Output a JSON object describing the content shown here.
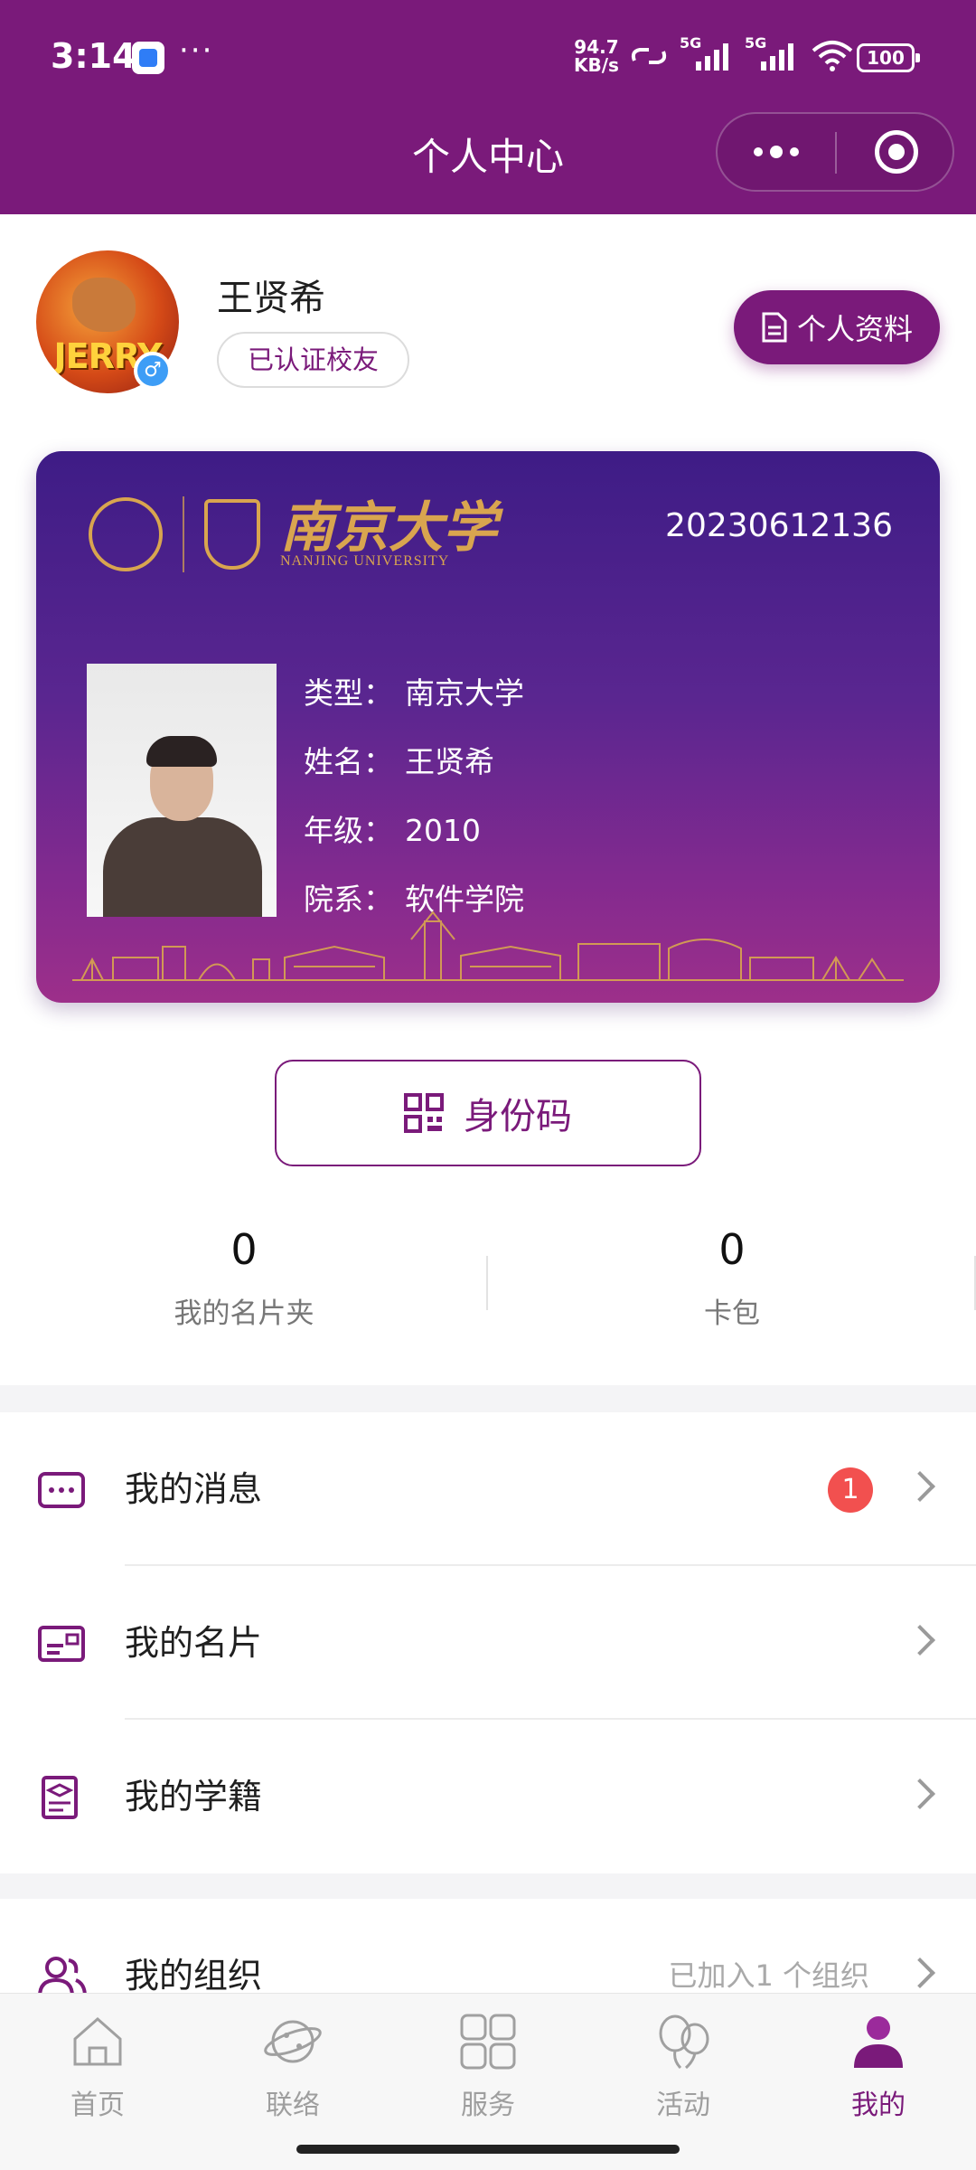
{
  "status": {
    "time": "3:14",
    "more": "···",
    "speed_value": "94.7",
    "speed_unit": "KB/s",
    "net1": "5G",
    "net2": "5G",
    "battery": "100"
  },
  "header": {
    "title": "个人中心"
  },
  "user": {
    "name": "王贤希",
    "badge": "已认证校友",
    "avatar_text": "JERRY",
    "profile_button": "个人资料"
  },
  "card": {
    "university_cn": "南京大学",
    "university_en": "NANJING UNIVERSITY",
    "card_number": "20230612136",
    "fields": [
      {
        "key": "类型：",
        "value": "南京大学"
      },
      {
        "key": "姓名：",
        "value": "王贤希"
      },
      {
        "key": "年级：",
        "value": "2010"
      },
      {
        "key": "院系：",
        "value": "软件学院"
      }
    ]
  },
  "id_code_button": "身份码",
  "stats": [
    {
      "num": "0",
      "label": "我的名片夹"
    },
    {
      "num": "0",
      "label": "卡包"
    }
  ],
  "menu": {
    "messages": {
      "label": "我的消息",
      "badge": "1"
    },
    "business_card": {
      "label": "我的名片"
    },
    "student_status": {
      "label": "我的学籍"
    },
    "organization": {
      "label": "我的组织",
      "extra": "已加入1 个组织"
    }
  },
  "nav": [
    {
      "label": "首页",
      "icon": "home-icon"
    },
    {
      "label": "联络",
      "icon": "planet-icon"
    },
    {
      "label": "服务",
      "icon": "grid-icon"
    },
    {
      "label": "活动",
      "icon": "balloons-icon"
    },
    {
      "label": "我的",
      "icon": "user-icon"
    }
  ],
  "colors": {
    "brand": "#7a1a7a",
    "card_top": "#3e1c86",
    "card_bottom": "#9d2f8a",
    "badge_red": "#f2504f",
    "gold": "#d9a54f"
  }
}
